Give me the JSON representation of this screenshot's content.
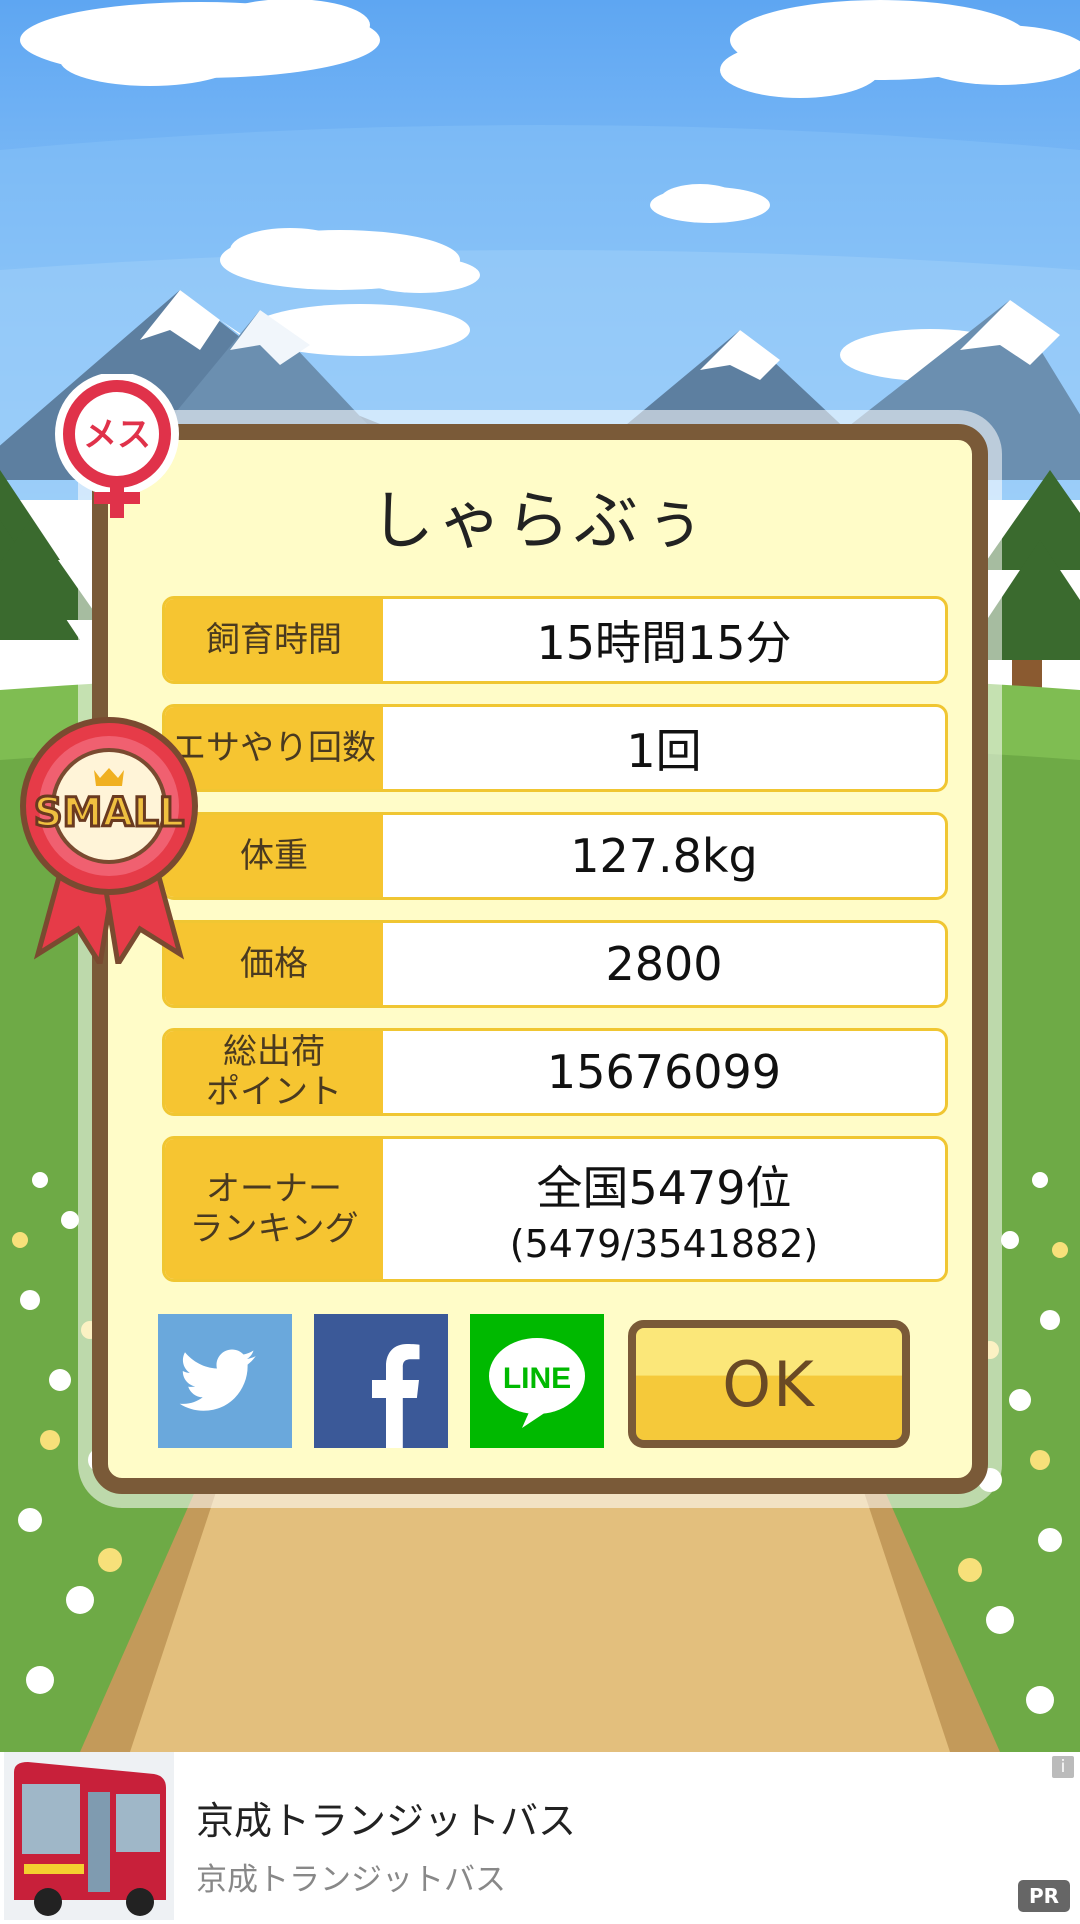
{
  "colors": {
    "sky": "#6cb1f6",
    "panel_bg": "#fffcc8",
    "panel_border": "#7a5a38",
    "label_bg": "#f6c531",
    "twitter": "#6aa8dc",
    "facebook": "#3b5998",
    "line": "#00b900"
  },
  "badges": {
    "gender_text": "メス",
    "ribbon_text": "SMALL"
  },
  "pig": {
    "name": "しゃらぶぅ",
    "stats": [
      {
        "label": "飼育時間",
        "value": "15時間15分"
      },
      {
        "label": "エサやり回数",
        "value": "1回"
      },
      {
        "label": "体重",
        "value": "127.8kg"
      },
      {
        "label": "価格",
        "value": "2800"
      },
      {
        "label": "総出荷\nポイント",
        "value": "15676099"
      },
      {
        "label": "オーナー\nランキング",
        "value": "全国5479位",
        "sub": "(5479/3541882)"
      }
    ]
  },
  "share": {
    "twitter_icon": "twitter-bird-icon",
    "facebook_icon": "facebook-f-icon",
    "line_label": "LINE"
  },
  "ok_label": "OK",
  "ad": {
    "title": "京成トランジットバス",
    "subtitle": "京成トランジットバス",
    "info": "i",
    "pr_label": "PR"
  }
}
